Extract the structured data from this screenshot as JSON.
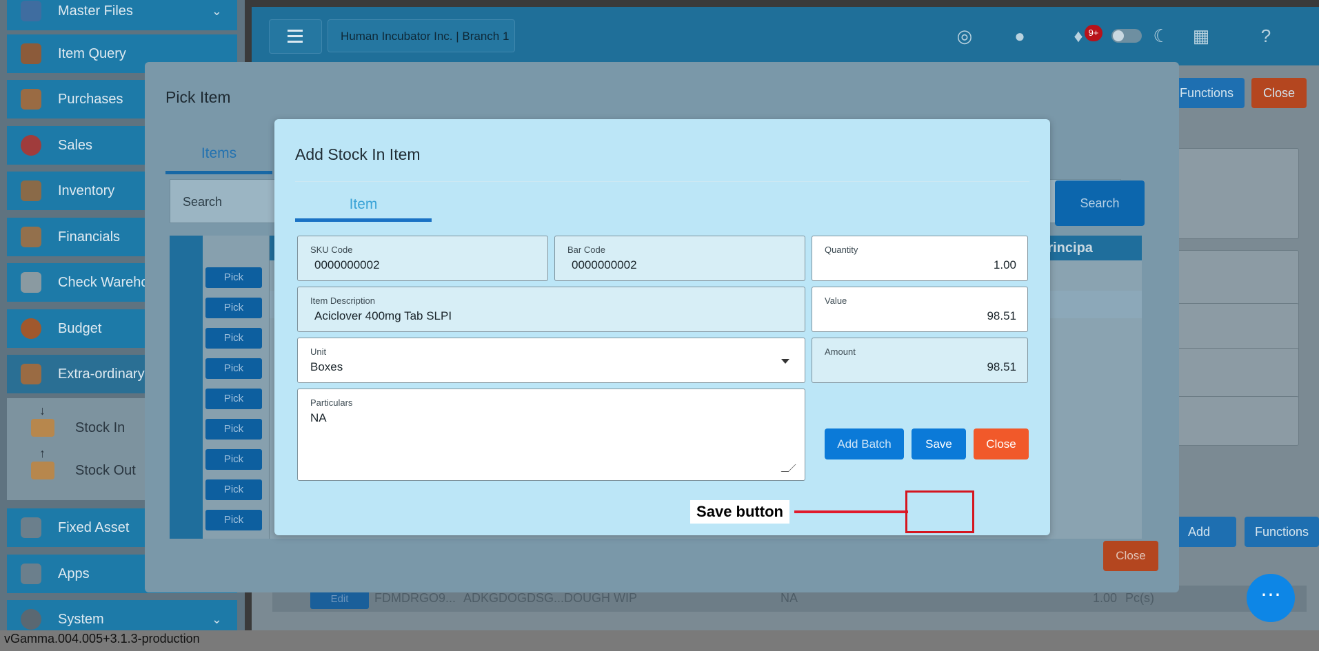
{
  "sidebar": {
    "items": [
      {
        "label": "Master Files",
        "icon": "folder-icon"
      },
      {
        "label": "Item Query",
        "icon": "basket-icon"
      },
      {
        "label": "Purchases",
        "icon": "receipt-icon"
      },
      {
        "label": "Sales",
        "icon": "sale-tag-icon"
      },
      {
        "label": "Inventory",
        "icon": "boxes-icon"
      },
      {
        "label": "Financials",
        "icon": "ledger-icon"
      },
      {
        "label": "Check Warehou",
        "icon": "warehouse-icon"
      },
      {
        "label": "Budget",
        "icon": "pie-icon"
      },
      {
        "label": "Extra-ordinary A",
        "icon": "document-icon"
      },
      {
        "label": "Fixed Asset",
        "icon": "asset-icon"
      },
      {
        "label": "Apps",
        "icon": "apps-icon"
      },
      {
        "label": "System",
        "icon": "gear-icon"
      }
    ],
    "sub_items": [
      {
        "label": "Stock In"
      },
      {
        "label": "Stock Out"
      }
    ]
  },
  "topbar": {
    "branch": "Human Incubator Inc. | Branch 1",
    "notif_badge": "9+"
  },
  "background_page": {
    "functions_label": "Functions",
    "close_label": "Close",
    "add_label": "Add",
    "functions2_label": "Functions",
    "row": {
      "edit_label": "Edit",
      "code": "FDMDRGO9...",
      "sku": "ADKGDOGDSG...",
      "desc": "DOUGH WIP",
      "na": "NA",
      "qty": "1.00",
      "unit": "Pc(s)"
    }
  },
  "pick_modal": {
    "title": "Pick Item",
    "tab": "Items",
    "search_placeholder": "Search",
    "search_button": "Search",
    "column_header": "Principa",
    "pick_label": "Pick",
    "close_label": "Close"
  },
  "stock_modal": {
    "title": "Add Stock In Item",
    "tab": "Item",
    "fields": {
      "sku_label": "SKU Code",
      "sku_value": "0000000002",
      "barcode_label": "Bar Code",
      "barcode_value": "0000000002",
      "quantity_label": "Quantity",
      "quantity_value": "1.00",
      "desc_label": "Item Description",
      "desc_value": "Aciclover 400mg Tab SLPI",
      "value_label": "Value",
      "value_value": "98.51",
      "unit_label": "Unit",
      "unit_value": "Boxes",
      "amount_label": "Amount",
      "amount_value": "98.51",
      "particulars_label": "Particulars",
      "particulars_value": "NA"
    },
    "buttons": {
      "add_batch": "Add Batch",
      "save": "Save",
      "close": "Close"
    }
  },
  "annotation": {
    "label": "Save button",
    "color": "#e01b2c"
  },
  "status": {
    "version": "vGamma.004.005+3.1.3-production"
  },
  "colors": {
    "accent": "#0b7ad8",
    "danger": "#f1592a",
    "modal_bg": "#bce6f7"
  }
}
